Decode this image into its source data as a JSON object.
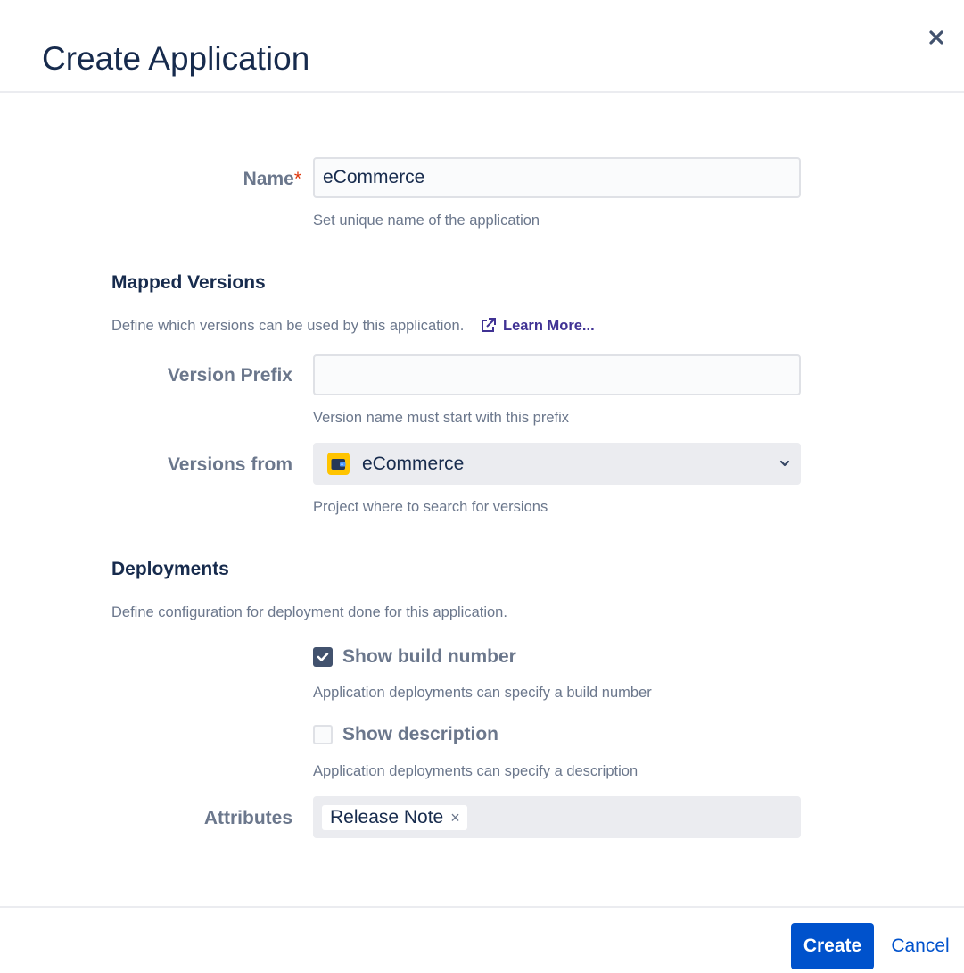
{
  "dialog": {
    "title": "Create Application",
    "close_icon": "close-icon"
  },
  "name_field": {
    "label": "Name",
    "required_mark": "*",
    "value": "eCommerce",
    "help": "Set unique name of the application"
  },
  "mapped_versions": {
    "title": "Mapped Versions",
    "description": "Define which versions can be used by this application.",
    "learn_more_icon": "external-link-icon",
    "learn_more": "Learn More...",
    "version_prefix": {
      "label": "Version Prefix",
      "value": "",
      "help": "Version name must start with this prefix"
    },
    "versions_from": {
      "label": "Versions from",
      "project_icon": "wallet-icon",
      "value": "eCommerce",
      "help": "Project where to search for versions"
    }
  },
  "deployments": {
    "title": "Deployments",
    "description": "Define configuration for deployment done for this application.",
    "show_build_number": {
      "label": "Show build number",
      "checked": true,
      "help": "Application deployments can specify a build number"
    },
    "show_description": {
      "label": "Show description",
      "checked": false,
      "help": "Application deployments can specify a description"
    },
    "attributes": {
      "label": "Attributes",
      "tags": [
        "Release Note"
      ],
      "remove_glyph": "×"
    }
  },
  "footer": {
    "create_label": "Create",
    "cancel_label": "Cancel"
  },
  "colors": {
    "primary": "#0052cc",
    "required": "#de350b",
    "link_purple": "#403294",
    "project_icon_bg": "#ffc400",
    "checkbox_checked": "#42526e"
  }
}
